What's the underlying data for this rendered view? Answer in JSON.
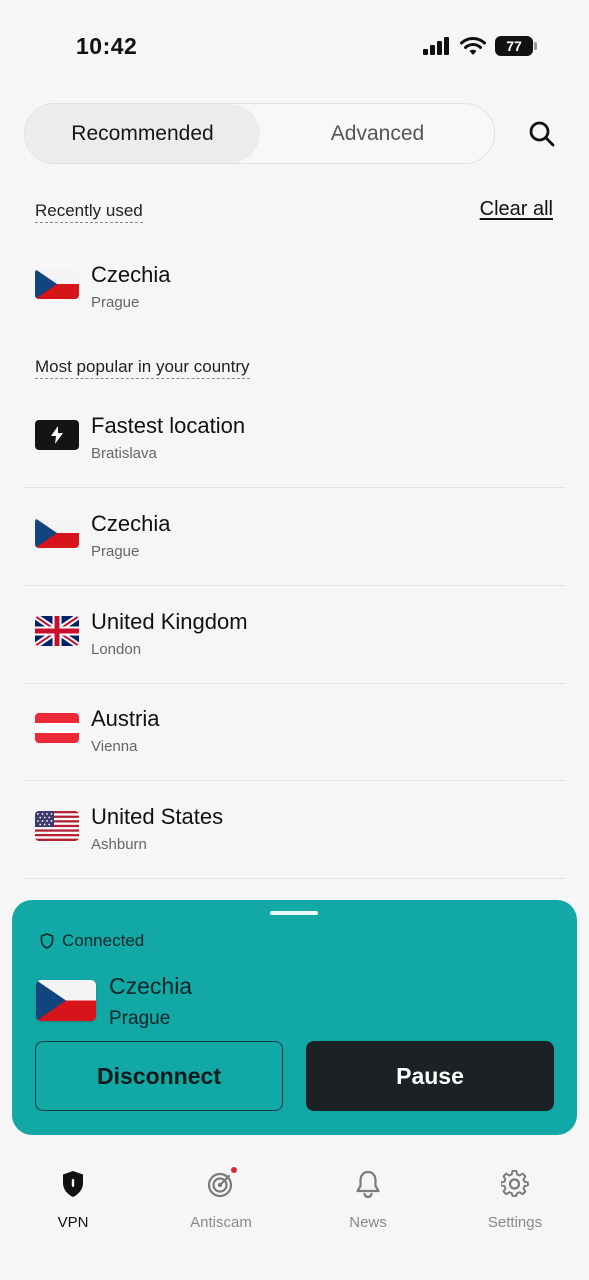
{
  "status_bar": {
    "time": "10:42",
    "battery": "77"
  },
  "tabs": [
    {
      "label": "Recommended",
      "selected": true
    },
    {
      "label": "Advanced",
      "selected": false
    }
  ],
  "recent": {
    "header": "Recently used",
    "clear_label": "Clear all",
    "items": [
      {
        "name": "Czechia",
        "city": "Prague",
        "flag": "czechia-flag"
      }
    ]
  },
  "popular": {
    "header": "Most popular in your country",
    "items": [
      {
        "name": "Fastest location",
        "city": "Bratislava",
        "flag": "lightning-icon"
      },
      {
        "name": "Czechia",
        "city": "Prague",
        "flag": "czechia-flag"
      },
      {
        "name": "United Kingdom",
        "city": "London",
        "flag": "uk-flag"
      },
      {
        "name": "Austria",
        "city": "Vienna",
        "flag": "austria-flag"
      },
      {
        "name": "United States",
        "city": "Ashburn",
        "flag": "usa-flag"
      }
    ]
  },
  "connection": {
    "status": "Connected",
    "country": "Czechia",
    "city": "Prague",
    "disconnect_label": "Disconnect",
    "pause_label": "Pause"
  },
  "nav": [
    {
      "label": "VPN",
      "icon": "shield-icon",
      "active": true
    },
    {
      "label": "Antiscam",
      "icon": "radar-icon",
      "active": false
    },
    {
      "label": "News",
      "icon": "bell-icon",
      "active": false
    },
    {
      "label": "Settings",
      "icon": "gear-icon",
      "active": false
    }
  ],
  "colors": {
    "panel": "#11a8a5",
    "pause_button": "#1c2126",
    "background": "#f6f6f6"
  }
}
